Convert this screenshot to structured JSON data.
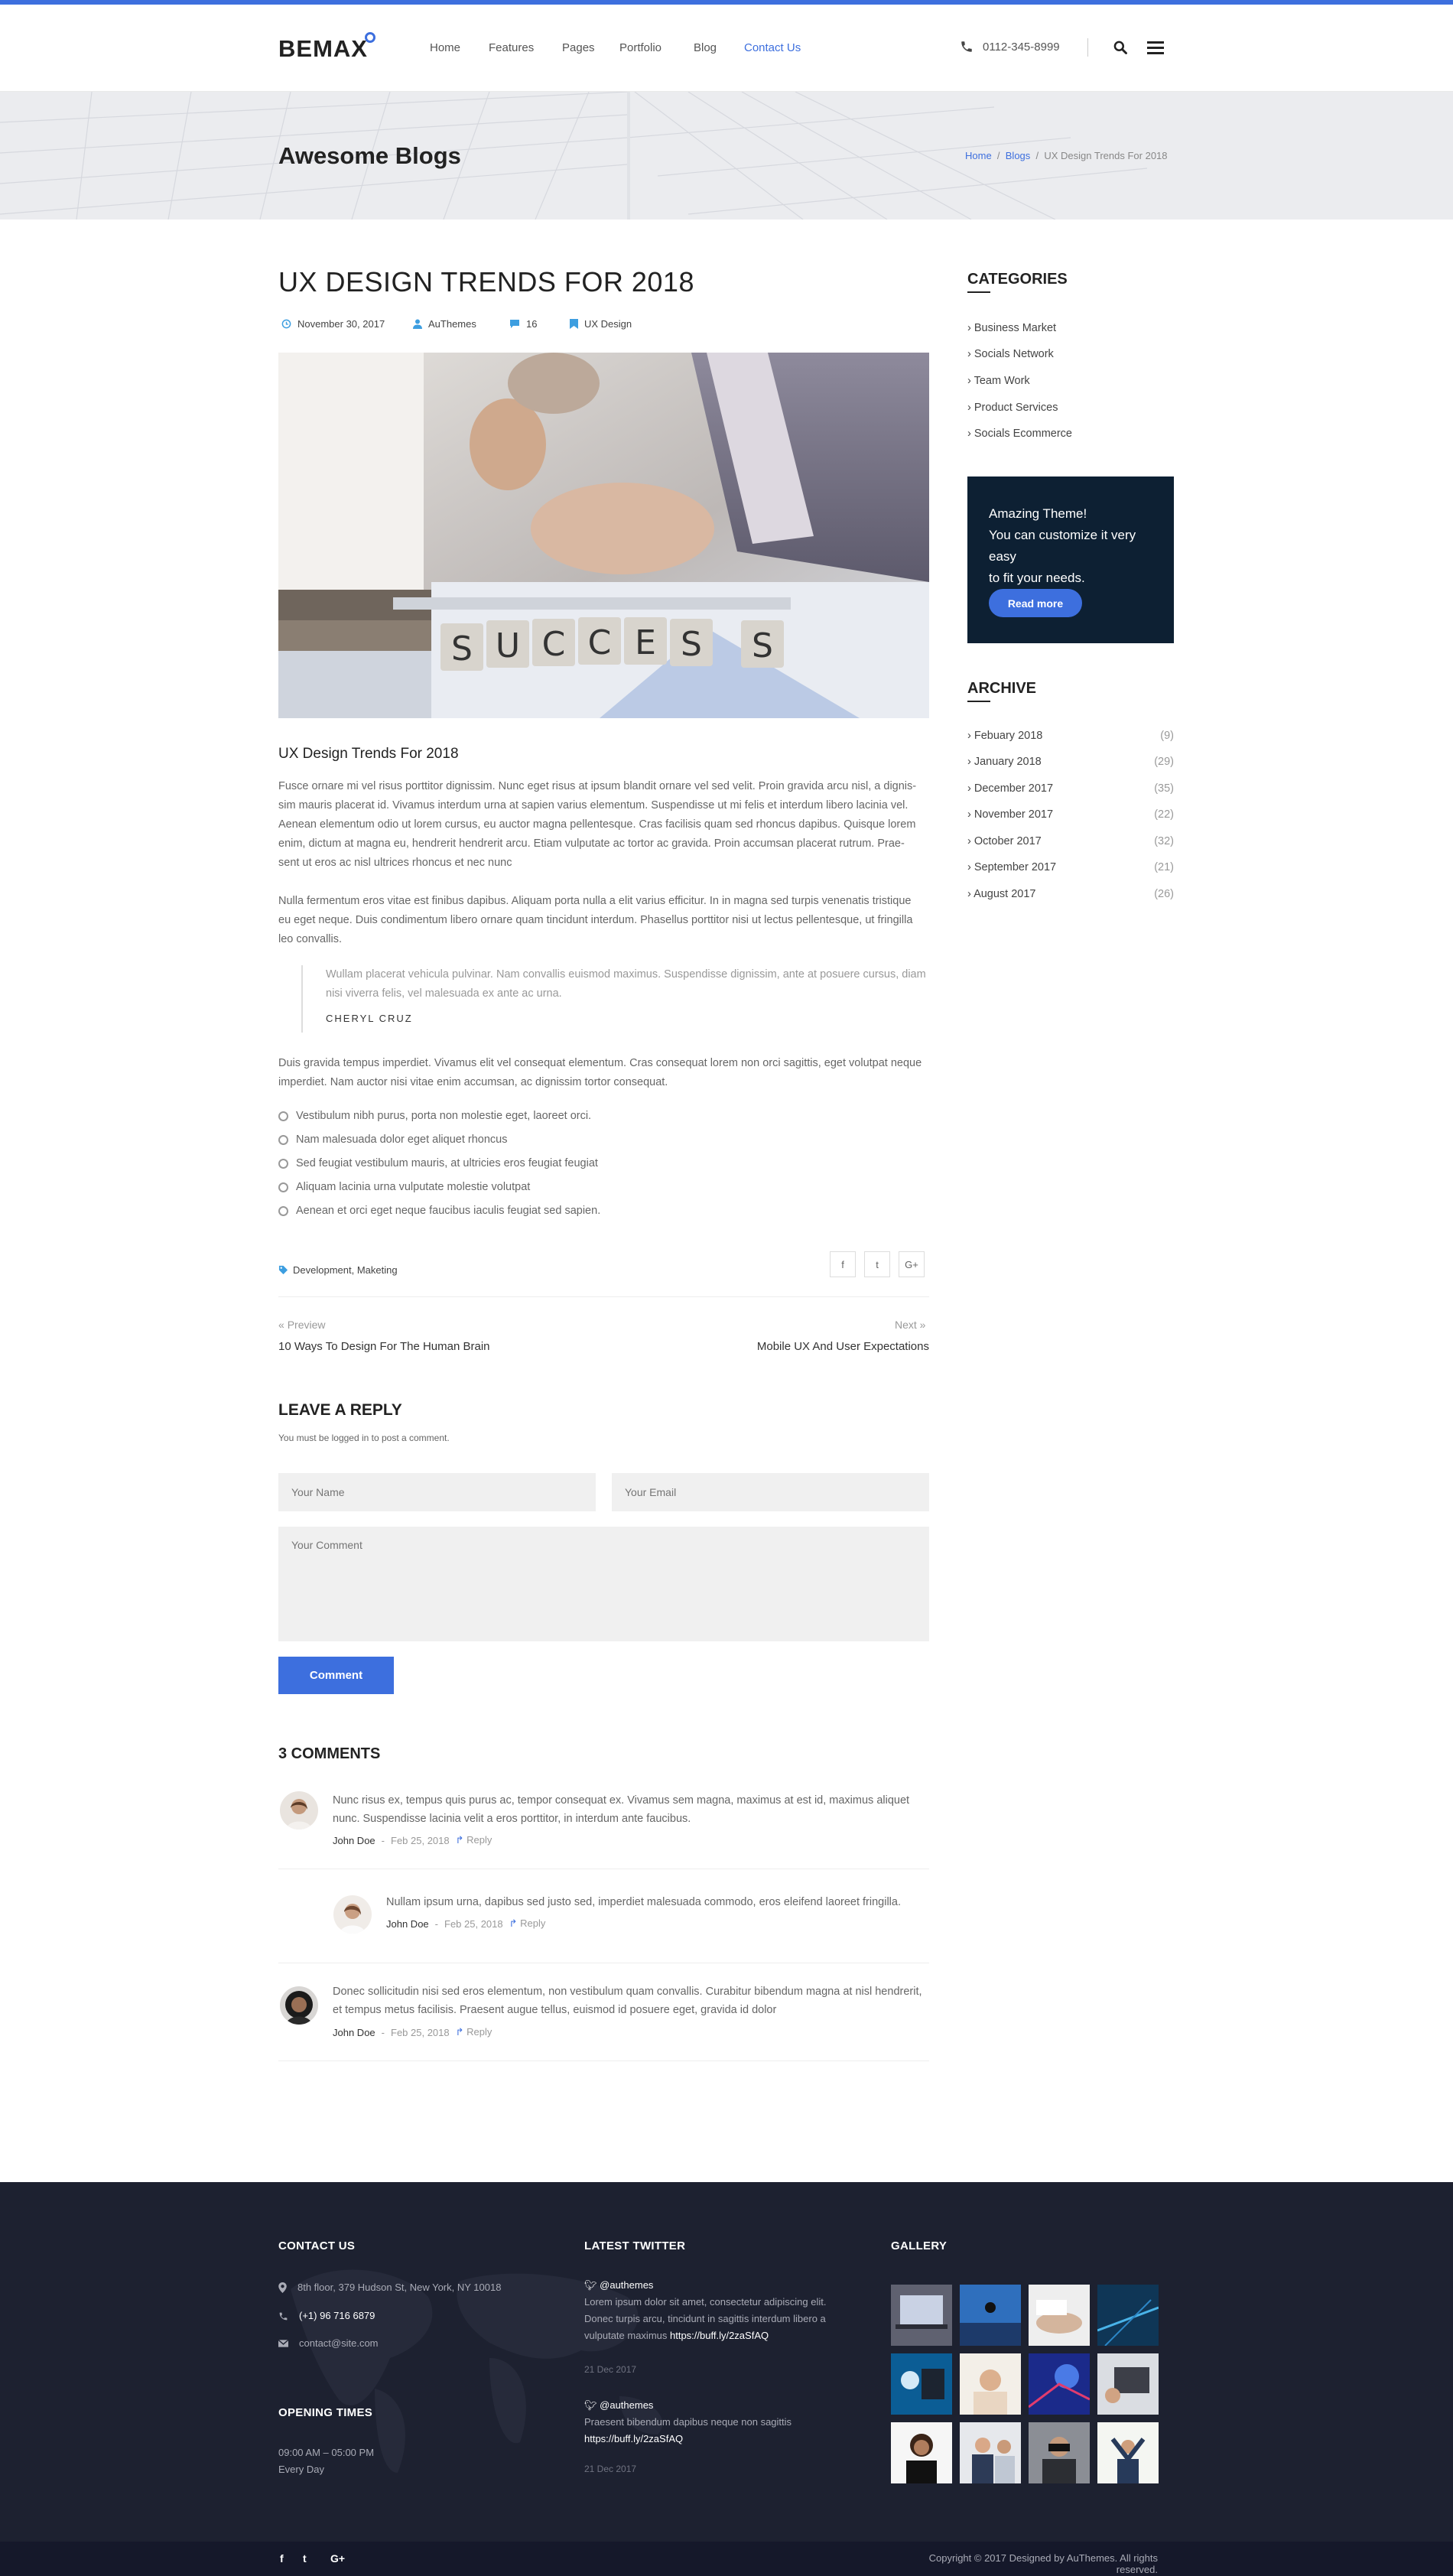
{
  "brand": {
    "logo": "BEMAX",
    "accent": "#3d6fde"
  },
  "nav": {
    "items": [
      "Home",
      "Features",
      "Pages",
      "Portfolio",
      "Blog",
      "Contact Us"
    ],
    "active_index": 5
  },
  "header": {
    "phone": "0112-345-8999"
  },
  "banner": {
    "title": "Awesome Blogs",
    "breadcrumb": [
      "Home",
      "Blogs",
      "UX Design Trends For 2018"
    ]
  },
  "post": {
    "title": "UX DESIGN TRENDS FOR 2018",
    "meta": {
      "date": "November 30, 2017",
      "author": "AuThemes",
      "comments": "16",
      "category": "UX Design"
    },
    "hero_text": "SUCCESS",
    "subtitle": "UX Design Trends For 2018",
    "para1_lines": [
      "Fusce ornare mi vel risus porttitor dignissim. Nunc eget risus at ipsum blandit ornare vel sed velit. Proin gravida arcu nisl, a dignis-",
      "sim mauris placerat id. Vivamus interdum urna at sapien varius elementum. Suspendisse ut mi felis et interdum libero lacinia vel.",
      "Aenean elementum odio ut lorem cursus, eu auctor magna pellentesque.  Cras facilisis quam sed rhoncus dapibus. Quisque lorem",
      "enim, dictum at magna eu, hendrerit hendrerit arcu. Etiam vulputate ac tortor ac gravida. Proin accumsan placerat rutrum. Prae-",
      "sent ut eros ac nisl ultrices rhoncus et nec nunc"
    ],
    "para2_lines": [
      "Nulla fermentum eros vitae est finibus dapibus. Aliquam porta nulla a elit varius efficitur. In in magna sed turpis venenatis tristique",
      "eu eget neque. Duis condimentum libero ornare quam tincidunt interdum. Phasellus porttitor nisi ut lectus pellentesque, ut fringilla",
      "leo convallis."
    ],
    "quote_lines": [
      "Wullam placerat vehicula pulvinar. Nam convallis euismod maximus. Suspendisse dignissim, ante at posuere cursus, diam",
      "nisi viverra felis, vel malesuada ex ante ac urna."
    ],
    "quote_author": "CHERYL CRUZ",
    "para3_lines": [
      "Duis gravida tempus imperdiet. Vivamus elit vel consequat elementum. Cras consequat lorem non orci sagittis, eget volutpat neque",
      "imperdiet. Nam auctor nisi vitae enim accumsan, ac dignissim tortor consequat."
    ],
    "list": [
      "Vestibulum nibh purus, porta non molestie eget, laoreet orci.",
      "Nam malesuada dolor eget aliquet rhoncus",
      "Sed feugiat vestibulum mauris, at ultricies eros feugiat feugiat",
      "Aliquam lacinia urna vulputate molestie volutpat",
      "Aenean et orci eget neque faucibus iaculis feugiat sed sapien."
    ],
    "tags": "Development, Maketing",
    "share": [
      "f",
      "t",
      "G+"
    ]
  },
  "post_nav": {
    "prev_label": "Preview",
    "prev_title": "10 Ways To Design For The Human Brain",
    "next_label": "Next",
    "next_title": "Mobile UX And User Expectations"
  },
  "reply": {
    "title": "LEAVE A REPLY",
    "note": "You must be logged in to post a comment.",
    "name_placeholder": "Your Name",
    "email_placeholder": "Your Email",
    "comment_placeholder": "Your Comment",
    "button": "Comment"
  },
  "comments": {
    "title": "3 COMMENTS",
    "items": [
      {
        "lines": [
          "Nunc risus ex, tempus quis purus ac, tempor consequat ex. Vivamus sem magna, maximus at est id, maximus aliquet",
          "nunc. Suspendisse lacinia velit a eros porttitor, in interdum ante faucibus."
        ],
        "author": "John Doe",
        "date": "Feb 25, 2018",
        "reply": "Reply"
      },
      {
        "lines": [
          "Nullam ipsum urna, dapibus sed justo sed, imperdiet malesuada commodo, eros eleifend laoreet fringilla."
        ],
        "author": "John Doe",
        "date": "Feb 25, 2018",
        "reply": "Reply"
      },
      {
        "lines": [
          "Donec sollicitudin nisi sed eros elementum, non vestibulum quam convallis. Curabitur bibendum magna at nisl hendrerit,",
          "et tempus metus facilisis. Praesent augue tellus, euismod id posuere eget, gravida id dolor"
        ],
        "author": "John Doe",
        "date": "Feb 25, 2018",
        "reply": "Reply"
      }
    ]
  },
  "sidebar": {
    "categories_title": "CATEGORIES",
    "categories": [
      "Business Market",
      "Socials Network",
      "Team Work",
      "Product Services",
      "Socials Ecommerce"
    ],
    "promo_lines": [
      "Amazing Theme!",
      "You can customize it very easy",
      "to fit your needs."
    ],
    "promo_button": "Read more",
    "archive_title": "ARCHIVE",
    "archive": [
      {
        "label": "Febuary 2018",
        "count": "(9)"
      },
      {
        "label": "January 2018",
        "count": "(29)"
      },
      {
        "label": "December 2017",
        "count": "(35)"
      },
      {
        "label": "November 2017",
        "count": "(22)"
      },
      {
        "label": "October 2017",
        "count": "(32)"
      },
      {
        "label": "September 2017",
        "count": "(21)"
      },
      {
        "label": "August 2017",
        "count": "(26)"
      }
    ]
  },
  "footer": {
    "contact_title": "CONTACT US",
    "address": "8th floor, 379 Hudson St, New York, NY 10018",
    "phone": "(+1) 96 716 6879",
    "email": "contact@site.com",
    "hours_title": "OPENING TIMES",
    "hours": "09:00 AM – 05:00 PM",
    "days": "Every Day",
    "twitter_title": "LATEST TWITTER",
    "tweets": [
      {
        "handle": "@authemes",
        "lines": [
          "Lorem ipsum dolor sit amet, consectetur adipiscing elit.",
          "Donec turpis arcu, tincidunt in sagittis interdum libero a",
          "vulputate maximus "
        ],
        "link": "https://buff.ly/2zaSfAQ",
        "date": "21 Dec 2017"
      },
      {
        "handle": "@authemes",
        "lines": [
          "Praesent bibendum dapibus neque non sagittis"
        ],
        "link": "https://buff.ly/2zaSfAQ",
        "date": "21 Dec 2017"
      }
    ],
    "gallery_title": "GALLERY",
    "copyright": "Copyright © 2017 Designed by AuThemes. All rights reserved.",
    "social": [
      "f",
      "t",
      "G+"
    ]
  }
}
